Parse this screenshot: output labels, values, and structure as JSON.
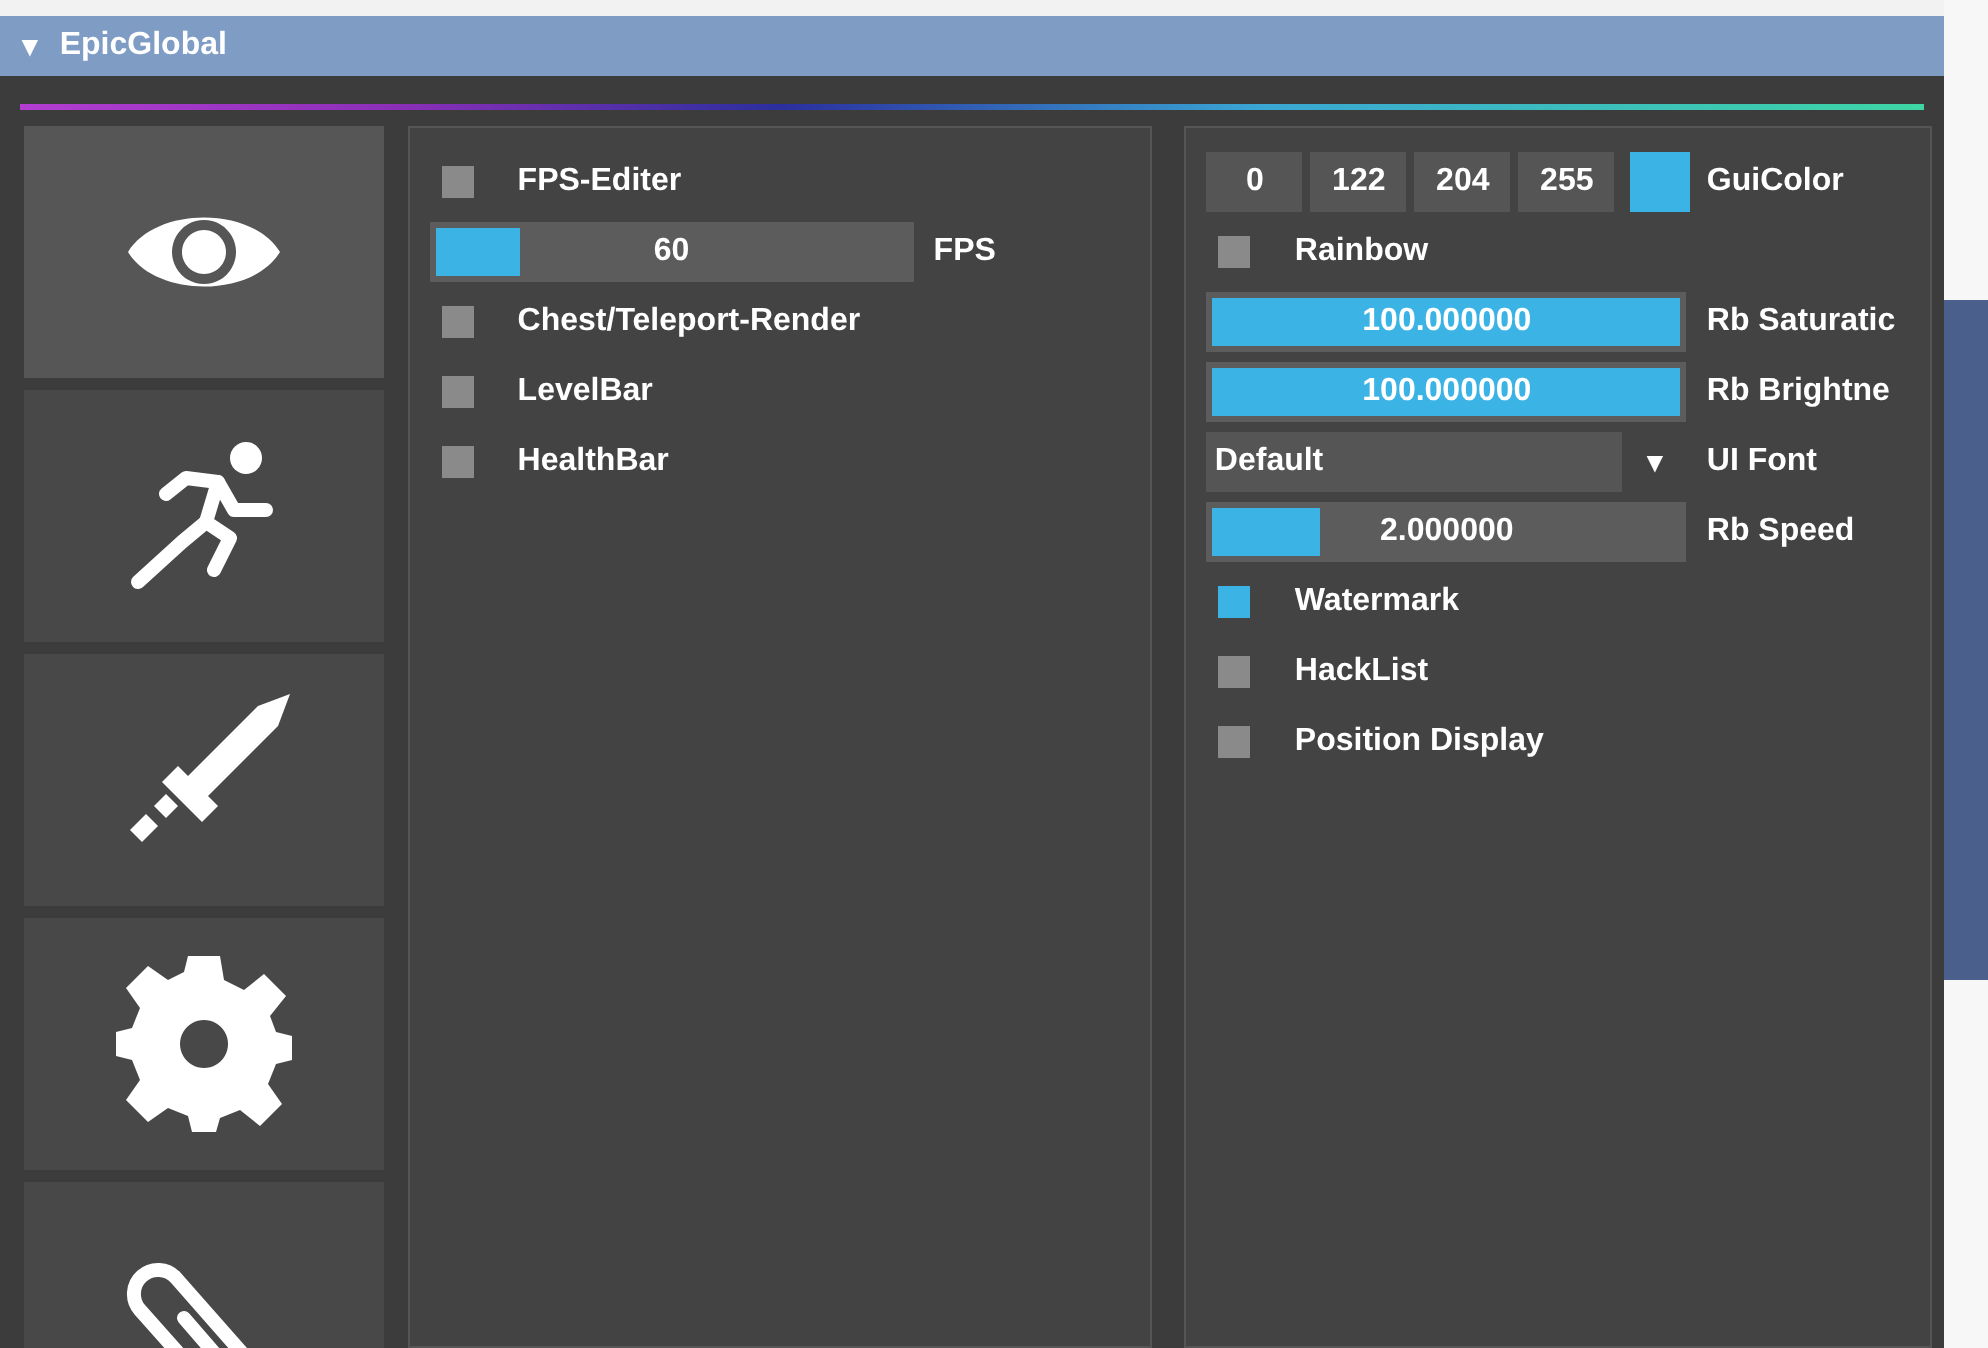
{
  "window": {
    "title": "EpicGlobal",
    "collapse_glyph": "▼"
  },
  "tabs": [
    {
      "selected": true
    },
    {
      "selected": false
    },
    {
      "selected": false
    },
    {
      "selected": false
    },
    {
      "selected": false
    }
  ],
  "left_panel": [
    {
      "kind": "checkbox",
      "label": "FPS-Editer",
      "checked": false
    },
    {
      "kind": "slider",
      "reading": "60",
      "label": "FPS",
      "level": 0.2
    },
    {
      "kind": "checkbox",
      "label": "Chest/Teleport-Render",
      "checked": false
    },
    {
      "kind": "checkbox",
      "label": "LevelBar",
      "checked": false
    },
    {
      "kind": "checkbox",
      "label": "HealthBar",
      "checked": false
    }
  ],
  "right_panel": [
    {
      "kind": "color",
      "values": [
        "0",
        "122",
        "204",
        "255"
      ],
      "color": "#3bb4e5",
      "label": "GuiColor"
    },
    {
      "kind": "checkbox",
      "label": "Rainbow",
      "checked": false
    },
    {
      "kind": "slider",
      "reading": "100.000000",
      "label": "Rb Saturatic",
      "level": 1
    },
    {
      "kind": "slider",
      "reading": "100.000000",
      "label": "Rb Brightne",
      "level": 1
    },
    {
      "kind": "dropdown",
      "value": "Default",
      "arrow": "▼",
      "label": "UI Font"
    },
    {
      "kind": "slider",
      "reading": "2.000000",
      "label": "Rb Speed",
      "level": 0.25
    },
    {
      "kind": "checkbox",
      "label": "Watermark",
      "checked": true
    },
    {
      "kind": "checkbox",
      "label": "HackList",
      "checked": false
    },
    {
      "kind": "checkbox",
      "label": "Position Display",
      "checked": false
    }
  ]
}
